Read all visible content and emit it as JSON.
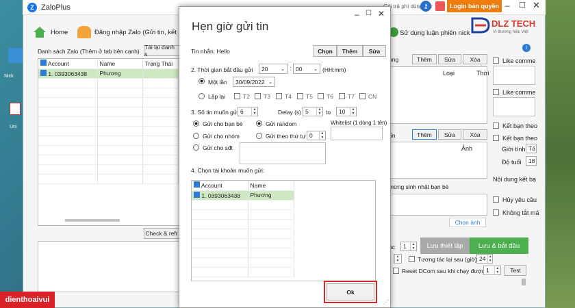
{
  "app": {
    "title": "ZaloPlus",
    "trial": "Gói trả phí dùng thử",
    "buy": "Login bản quyền",
    "nav_home": "Home",
    "nav_login": "Đăng nhập Zalo (Gửi tin, kết",
    "nav_right": "Sử dụng luận phiên nick"
  },
  "brand": {
    "name": "DLZ TECH",
    "sub": "Vì thương hiệu Việt",
    "watermark": "dienthoaivui"
  },
  "left": {
    "header": "Danh sách Zalo (Thêm ở tab bên cạnh)",
    "reload": "Tải lại danh s",
    "columns": [
      "Account",
      "Name",
      "Trạng Thái"
    ],
    "rows": [
      {
        "account": "1. 0393063438",
        "name": "Phương",
        "status": ""
      }
    ],
    "check_btn": "Check & refr"
  },
  "desk_icons": [
    "Nick",
    "Uni"
  ],
  "right": {
    "top_label": "ung",
    "add": "Thêm",
    "edit": "Sửa",
    "del": "Xóa",
    "col_type": "Loại",
    "col_time": "Thời",
    "mid_label": "ẩn",
    "col_img": "Ảnh",
    "birthday": "mừng sinh nhật bạn bè",
    "choose_img": "Chọn ảnh",
    "delay_label": "úc",
    "delay_val": "1",
    "save_setup": "Lưu thiết lập",
    "save_start": "Lưu & bắt đầu",
    "interact_label": "Tương tác lại sau (giờ)",
    "interact_val": "24",
    "reset_label": "Reset DCom sau khi chạy được",
    "reset_val": "1",
    "test": "Test"
  },
  "side": {
    "like1": "Like comme",
    "like2": "Like comme",
    "friend1": "Kết bạn theo",
    "friend2": "Kết bạn theo",
    "gender": "Giới tính",
    "gender_val": "Tấ",
    "age": "Độ tuổi",
    "age_val": "18",
    "content": "Nội dung kết bạ",
    "cancel": "Hủy yêu cầu",
    "no_disable": "Không tắt má"
  },
  "dialog": {
    "title": "Hẹn giờ gửi tin",
    "msg_label": "Tin nhắn: Hello",
    "choose": "Chọn",
    "add": "Thêm",
    "edit": "Sửa",
    "s2": "2. Thời gian bắt đầu gửi",
    "hour": "20",
    "minute": "00",
    "hhmm": "(HH:mm)",
    "once": "Một lần",
    "date": "30/09/2022",
    "repeat": "Lặp lại",
    "days": [
      "T2",
      "T3",
      "T4",
      "T5",
      "T6",
      "T7",
      "CN"
    ],
    "s3": "3. Số tin muốn gửi",
    "count": "6",
    "delay": "Delay (s)",
    "d_from": "5",
    "to": "to",
    "d_to": "10",
    "to_friends": "Gửi cho bạn bè",
    "random": "Gửi random",
    "whitelist": "Whitelist (1 dòng 1 tên)",
    "to_group": "Gửi cho nhóm",
    "ordered": "Gửi theo thứ tự",
    "order_val": "0",
    "to_phone": "Gửi cho sđt",
    "s4": "4. Chọn tài khoản muốn gửi:",
    "columns": [
      "Account",
      "Name"
    ],
    "rows": [
      {
        "account": "1. 0393063438",
        "name": "Phương"
      }
    ],
    "ok": "Ok"
  }
}
